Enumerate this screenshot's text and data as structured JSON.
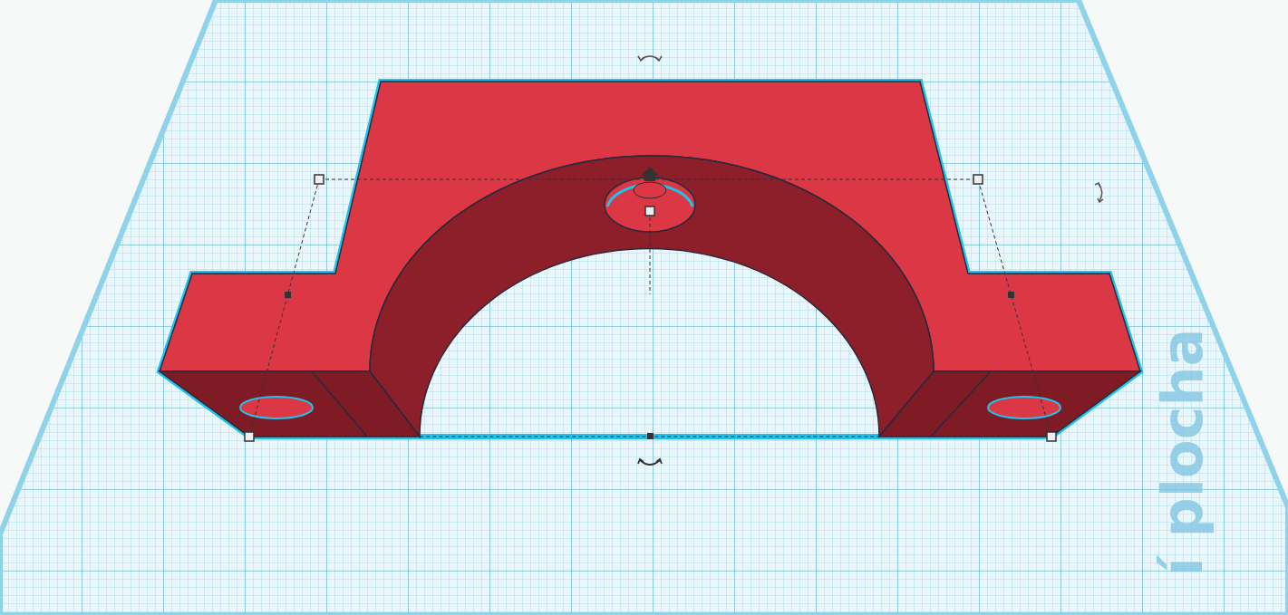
{
  "workplane": {
    "label": "í plocha"
  }
}
